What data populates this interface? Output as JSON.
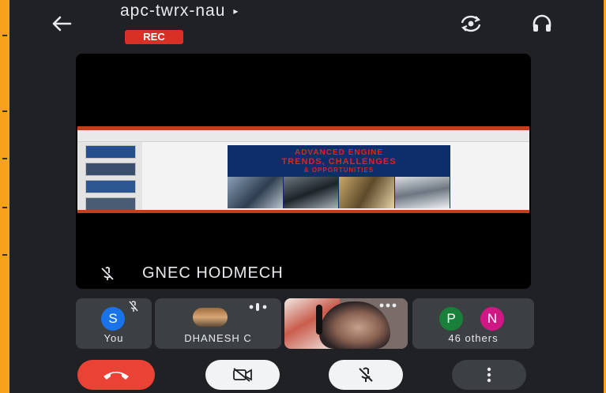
{
  "header": {
    "back_icon": "arrow-left-icon",
    "meeting_code": "apc-twrx-nau",
    "caret": "▸",
    "rec_badge": "REC",
    "switch_camera_icon": "switch-camera-icon",
    "audio_icon": "headphones-icon"
  },
  "main_tile": {
    "speaker_name": "GNEC HODMECH",
    "mic_state_icon": "mic-off-icon",
    "slide": {
      "line1": "ADVANCED ENGINE",
      "line2": "TRENDS, CHALLENGES",
      "line3": "& OPPORTUNITIES"
    }
  },
  "participants": [
    {
      "name": "You",
      "avatar_letter": "S",
      "avatar_color": "#1a73e8",
      "mic_icon": "mic-off-icon"
    },
    {
      "name": "DHANESH C",
      "more_icon": "more-horizontal-icon"
    },
    {
      "name": "",
      "more_icon": "more-horizontal-icon"
    },
    {
      "name": "46 others",
      "avatars": [
        {
          "letter": "P",
          "color": "#188038"
        },
        {
          "letter": "N",
          "color": "#d01884"
        }
      ]
    }
  ],
  "controls": {
    "end_call_icon": "end-call-icon",
    "camera_icon": "camera-off-icon",
    "mic_icon": "mic-off-icon",
    "more_icon": "more-vertical-icon"
  },
  "colors": {
    "background": "#202124",
    "tile": "#3c4043",
    "rec": "#d93025",
    "end_call": "#ea4335",
    "frame": "#f7a21b"
  }
}
